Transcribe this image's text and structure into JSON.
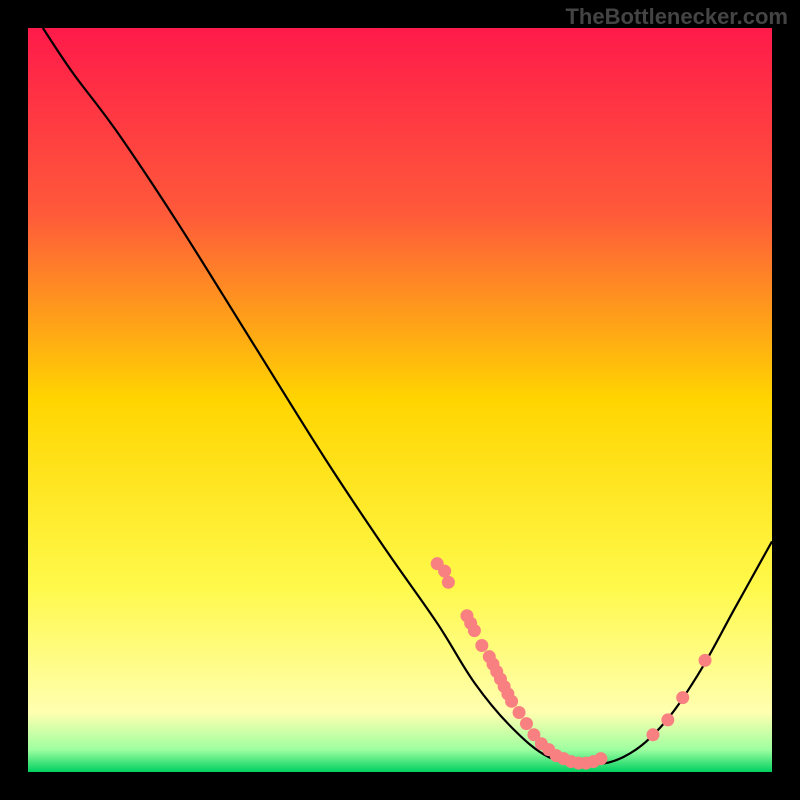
{
  "watermark": "TheBottlenecker.com",
  "chart_data": {
    "type": "line",
    "title": "",
    "xlabel": "",
    "ylabel": "",
    "xlim": [
      0,
      100
    ],
    "ylim": [
      0,
      100
    ],
    "gradient_stops": [
      {
        "offset": 0,
        "color": "#ff1a4a"
      },
      {
        "offset": 0.25,
        "color": "#ff5a3a"
      },
      {
        "offset": 0.5,
        "color": "#ffd500"
      },
      {
        "offset": 0.75,
        "color": "#fff94a"
      },
      {
        "offset": 0.92,
        "color": "#ffffb0"
      },
      {
        "offset": 0.97,
        "color": "#9effa0"
      },
      {
        "offset": 1.0,
        "color": "#00d060"
      }
    ],
    "series": [
      {
        "name": "curve",
        "type": "line",
        "points": [
          {
            "x": 2,
            "y": 100
          },
          {
            "x": 6,
            "y": 94
          },
          {
            "x": 12,
            "y": 86
          },
          {
            "x": 20,
            "y": 74
          },
          {
            "x": 30,
            "y": 58
          },
          {
            "x": 40,
            "y": 42
          },
          {
            "x": 48,
            "y": 30
          },
          {
            "x": 55,
            "y": 20
          },
          {
            "x": 60,
            "y": 12
          },
          {
            "x": 65,
            "y": 6
          },
          {
            "x": 70,
            "y": 2
          },
          {
            "x": 75,
            "y": 1
          },
          {
            "x": 80,
            "y": 2
          },
          {
            "x": 85,
            "y": 6
          },
          {
            "x": 90,
            "y": 13
          },
          {
            "x": 95,
            "y": 22
          },
          {
            "x": 100,
            "y": 31
          }
        ]
      },
      {
        "name": "markers",
        "type": "scatter",
        "color": "#f98080",
        "points": [
          {
            "x": 55,
            "y": 28
          },
          {
            "x": 56,
            "y": 27
          },
          {
            "x": 56.5,
            "y": 25.5
          },
          {
            "x": 59,
            "y": 21
          },
          {
            "x": 59.5,
            "y": 20
          },
          {
            "x": 60,
            "y": 19
          },
          {
            "x": 61,
            "y": 17
          },
          {
            "x": 62,
            "y": 15.5
          },
          {
            "x": 62.5,
            "y": 14.5
          },
          {
            "x": 63,
            "y": 13.5
          },
          {
            "x": 63.5,
            "y": 12.5
          },
          {
            "x": 64,
            "y": 11.5
          },
          {
            "x": 64.5,
            "y": 10.5
          },
          {
            "x": 65,
            "y": 9.5
          },
          {
            "x": 66,
            "y": 8
          },
          {
            "x": 67,
            "y": 6.5
          },
          {
            "x": 68,
            "y": 5
          },
          {
            "x": 69,
            "y": 3.8
          },
          {
            "x": 70,
            "y": 3
          },
          {
            "x": 71,
            "y": 2.2
          },
          {
            "x": 72,
            "y": 1.8
          },
          {
            "x": 73,
            "y": 1.4
          },
          {
            "x": 74,
            "y": 1.2
          },
          {
            "x": 75,
            "y": 1.2
          },
          {
            "x": 76,
            "y": 1.4
          },
          {
            "x": 77,
            "y": 1.8
          },
          {
            "x": 84,
            "y": 5
          },
          {
            "x": 86,
            "y": 7
          },
          {
            "x": 88,
            "y": 10
          },
          {
            "x": 91,
            "y": 15
          }
        ]
      }
    ]
  }
}
